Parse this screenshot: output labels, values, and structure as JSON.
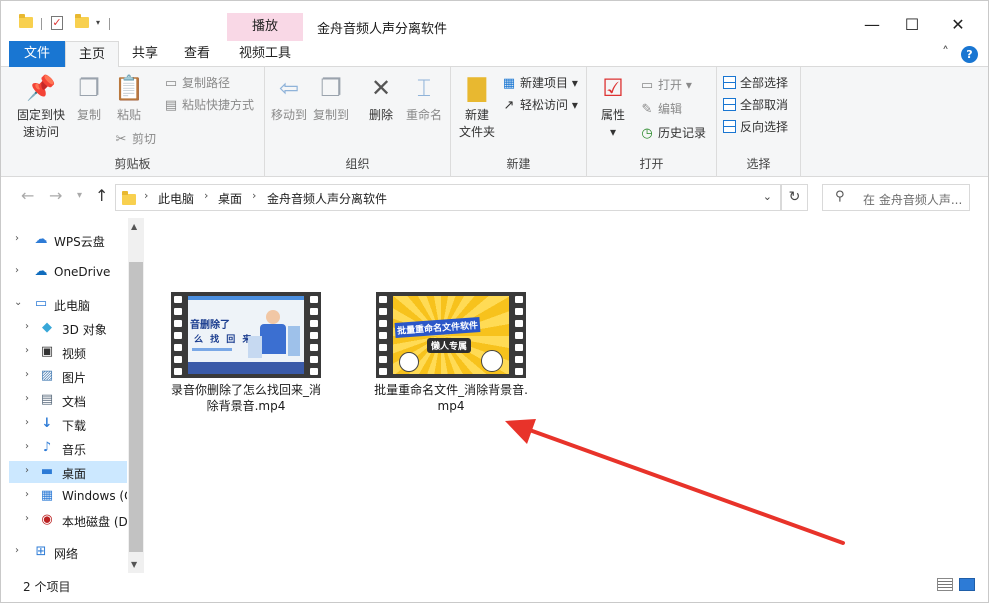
{
  "title_bar": {
    "contextual_tab": "播放",
    "window_title": "金舟音频人声分离软件",
    "minimize": "—",
    "maximize": "☐",
    "close": "✕"
  },
  "tabs": {
    "file": "文件",
    "home": "主页",
    "share": "共享",
    "view": "查看",
    "video_tools": "视频工具"
  },
  "ribbon": {
    "clipboard": {
      "label": "剪贴板",
      "pin_line1": "固定到快",
      "pin_line2": "速访问",
      "copy": "复制",
      "paste": "粘贴",
      "copy_path": "复制路径",
      "paste_shortcut": "粘贴快捷方式",
      "cut": "剪切"
    },
    "organize": {
      "label": "组织",
      "move_to": "移动到",
      "copy_to": "复制到",
      "delete": "删除",
      "rename": "重命名"
    },
    "new": {
      "label": "新建",
      "new_folder_line1": "新建",
      "new_folder_line2": "文件夹",
      "new_item": "新建项目",
      "easy_access": "轻松访问"
    },
    "open": {
      "label": "打开",
      "properties": "属性",
      "open": "打开",
      "edit": "编辑",
      "history": "历史记录"
    },
    "select": {
      "label": "选择",
      "select_all": "全部选择",
      "select_none": "全部取消",
      "invert": "反向选择"
    }
  },
  "address": {
    "crumbs": [
      "此电脑",
      "桌面",
      "金舟音频人声分离软件"
    ],
    "search_placeholder": "在 金舟音频人声..."
  },
  "nav": {
    "items": [
      {
        "label": "WPS云盘",
        "icon": "cloud-icon"
      },
      {
        "label": "OneDrive",
        "icon": "onedrive-icon"
      },
      {
        "label": "此电脑",
        "icon": "computer-icon"
      },
      {
        "label": "3D 对象",
        "icon": "3d-objects-icon"
      },
      {
        "label": "视频",
        "icon": "video-icon"
      },
      {
        "label": "图片",
        "icon": "pictures-icon"
      },
      {
        "label": "文档",
        "icon": "documents-icon"
      },
      {
        "label": "下载",
        "icon": "download-icon"
      },
      {
        "label": "音乐",
        "icon": "music-icon"
      },
      {
        "label": "桌面",
        "icon": "desktop-icon"
      },
      {
        "label": "Windows (C",
        "icon": "drive-c-icon"
      },
      {
        "label": "本地磁盘 (D",
        "icon": "drive-d-icon"
      },
      {
        "label": "网络",
        "icon": "network-icon"
      }
    ]
  },
  "files": [
    {
      "name": "录音你删除了怎么找回来_消除背景音.mp4",
      "thumb_text_1": "音删除了",
      "thumb_text_2": "么 找 回 来"
    },
    {
      "name": "批量重命名文件_消除背景音.mp4",
      "thumb_text_1": "批量重命名文件软件",
      "thumb_text_2": "懒人专属"
    }
  ],
  "status": {
    "item_count": "2 个项目"
  },
  "colors": {
    "accent": "#1976d2",
    "contextual_tab": "#f9d8e6",
    "selection": "#cce8ff",
    "arrow": "#e8332a"
  }
}
